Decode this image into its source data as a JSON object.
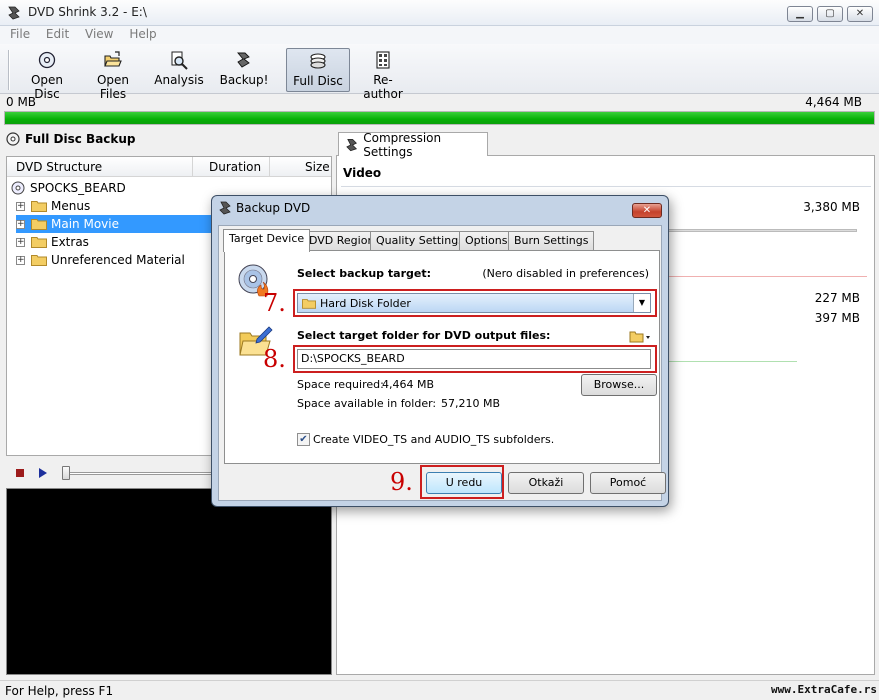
{
  "window": {
    "title": "DVD Shrink 3.2 - E:\\"
  },
  "menu": [
    "File",
    "Edit",
    "View",
    "Help"
  ],
  "toolbar": {
    "open_disc": "Open Disc",
    "open_files": "Open Files",
    "analysis": "Analysis",
    "backup": "Backup!",
    "full_disc": "Full Disc",
    "re_author": "Re-author"
  },
  "progress": {
    "left_label": "0 MB",
    "right_label": "4,464 MB",
    "fill_fraction": 1.0,
    "color": "#09b009"
  },
  "left": {
    "title": "Full Disc Backup",
    "columns": {
      "structure": "DVD Structure",
      "duration": "Duration",
      "size": "Size"
    },
    "root": "SPOCKS_BEARD",
    "items": [
      "Menus",
      "Main Movie",
      "Extras",
      "Unreferenced Material"
    ],
    "selected_index": 1
  },
  "right": {
    "tab": "Compression Settings",
    "section": "Video",
    "sizes": [
      "3,380 MB",
      "227 MB",
      "397 MB"
    ]
  },
  "status": {
    "text": "For Help, press F1",
    "site": "www.ExtraCafe.rs"
  },
  "dialog": {
    "title": "Backup DVD",
    "tabs": [
      "Target Device",
      "DVD Region",
      "Quality Settings",
      "Options",
      "Burn Settings"
    ],
    "select_target_label": "Select backup target:",
    "nero_note": "(Nero disabled in preferences)",
    "target_value": "Hard Disk Folder",
    "folder_label": "Select target folder for DVD output files:",
    "folder_value": "D:\\SPOCKS_BEARD",
    "space_required_label": "Space required:",
    "space_required_value": "4,464 MB",
    "space_available_label": "Space available in folder:",
    "space_available_value": "57,210 MB",
    "browse": "Browse...",
    "checkbox_label": "Create VIDEO_TS and AUDIO_TS subfolders.",
    "checkbox_checked": true,
    "ok": "U redu",
    "cancel": "Otkaži",
    "help": "Pomoć",
    "steps": [
      "7.",
      "8.",
      "9."
    ]
  }
}
